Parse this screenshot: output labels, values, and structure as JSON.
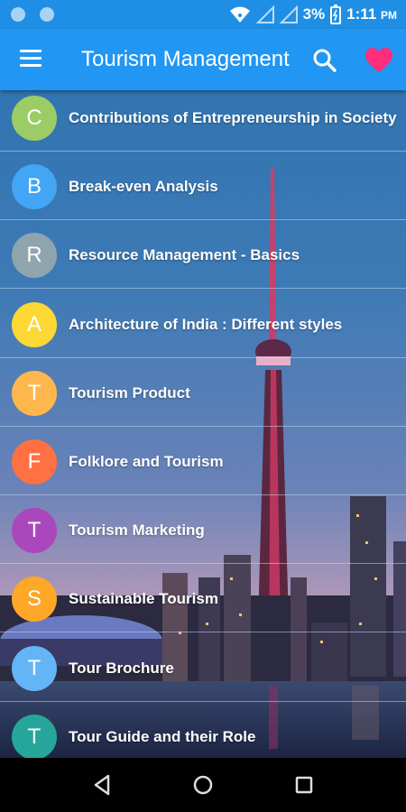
{
  "status_bar": {
    "battery": "3%",
    "time": "1:11",
    "time_suffix": "PM"
  },
  "app_bar": {
    "title": "Tourism Management",
    "menu_icon": "hamburger-menu-icon",
    "search_icon": "search-icon",
    "favorite_icon": "heart-icon",
    "favorite_color": "#ff2d7a"
  },
  "topics": [
    {
      "letter": "C",
      "title": "Contributions of Entrepreneurship in Society",
      "color": "#9ccc65"
    },
    {
      "letter": "B",
      "title": "Break-even Analysis",
      "color": "#42a5f5"
    },
    {
      "letter": "R",
      "title": "Resource Management - Basics",
      "color": "#90a4ae"
    },
    {
      "letter": "A",
      "title": "Architecture of India : Different styles",
      "color": "#fdd835"
    },
    {
      "letter": "T",
      "title": "Tourism Product",
      "color": "#ffb74d"
    },
    {
      "letter": "F",
      "title": "Folklore and Tourism",
      "color": "#ff7043"
    },
    {
      "letter": "T",
      "title": "Tourism Marketing",
      "color": "#ab47bc"
    },
    {
      "letter": "S",
      "title": "Sustainable Tourism",
      "color": "#ffa726"
    },
    {
      "letter": "T",
      "title": "Tour Brochure",
      "color": "#64b5f6"
    },
    {
      "letter": "T",
      "title": "Tour Guide and their Role",
      "color": "#26a69a"
    }
  ],
  "nav_bar": {
    "back_icon": "back-triangle-icon",
    "home_icon": "home-circle-icon",
    "recents_icon": "recents-square-icon"
  }
}
